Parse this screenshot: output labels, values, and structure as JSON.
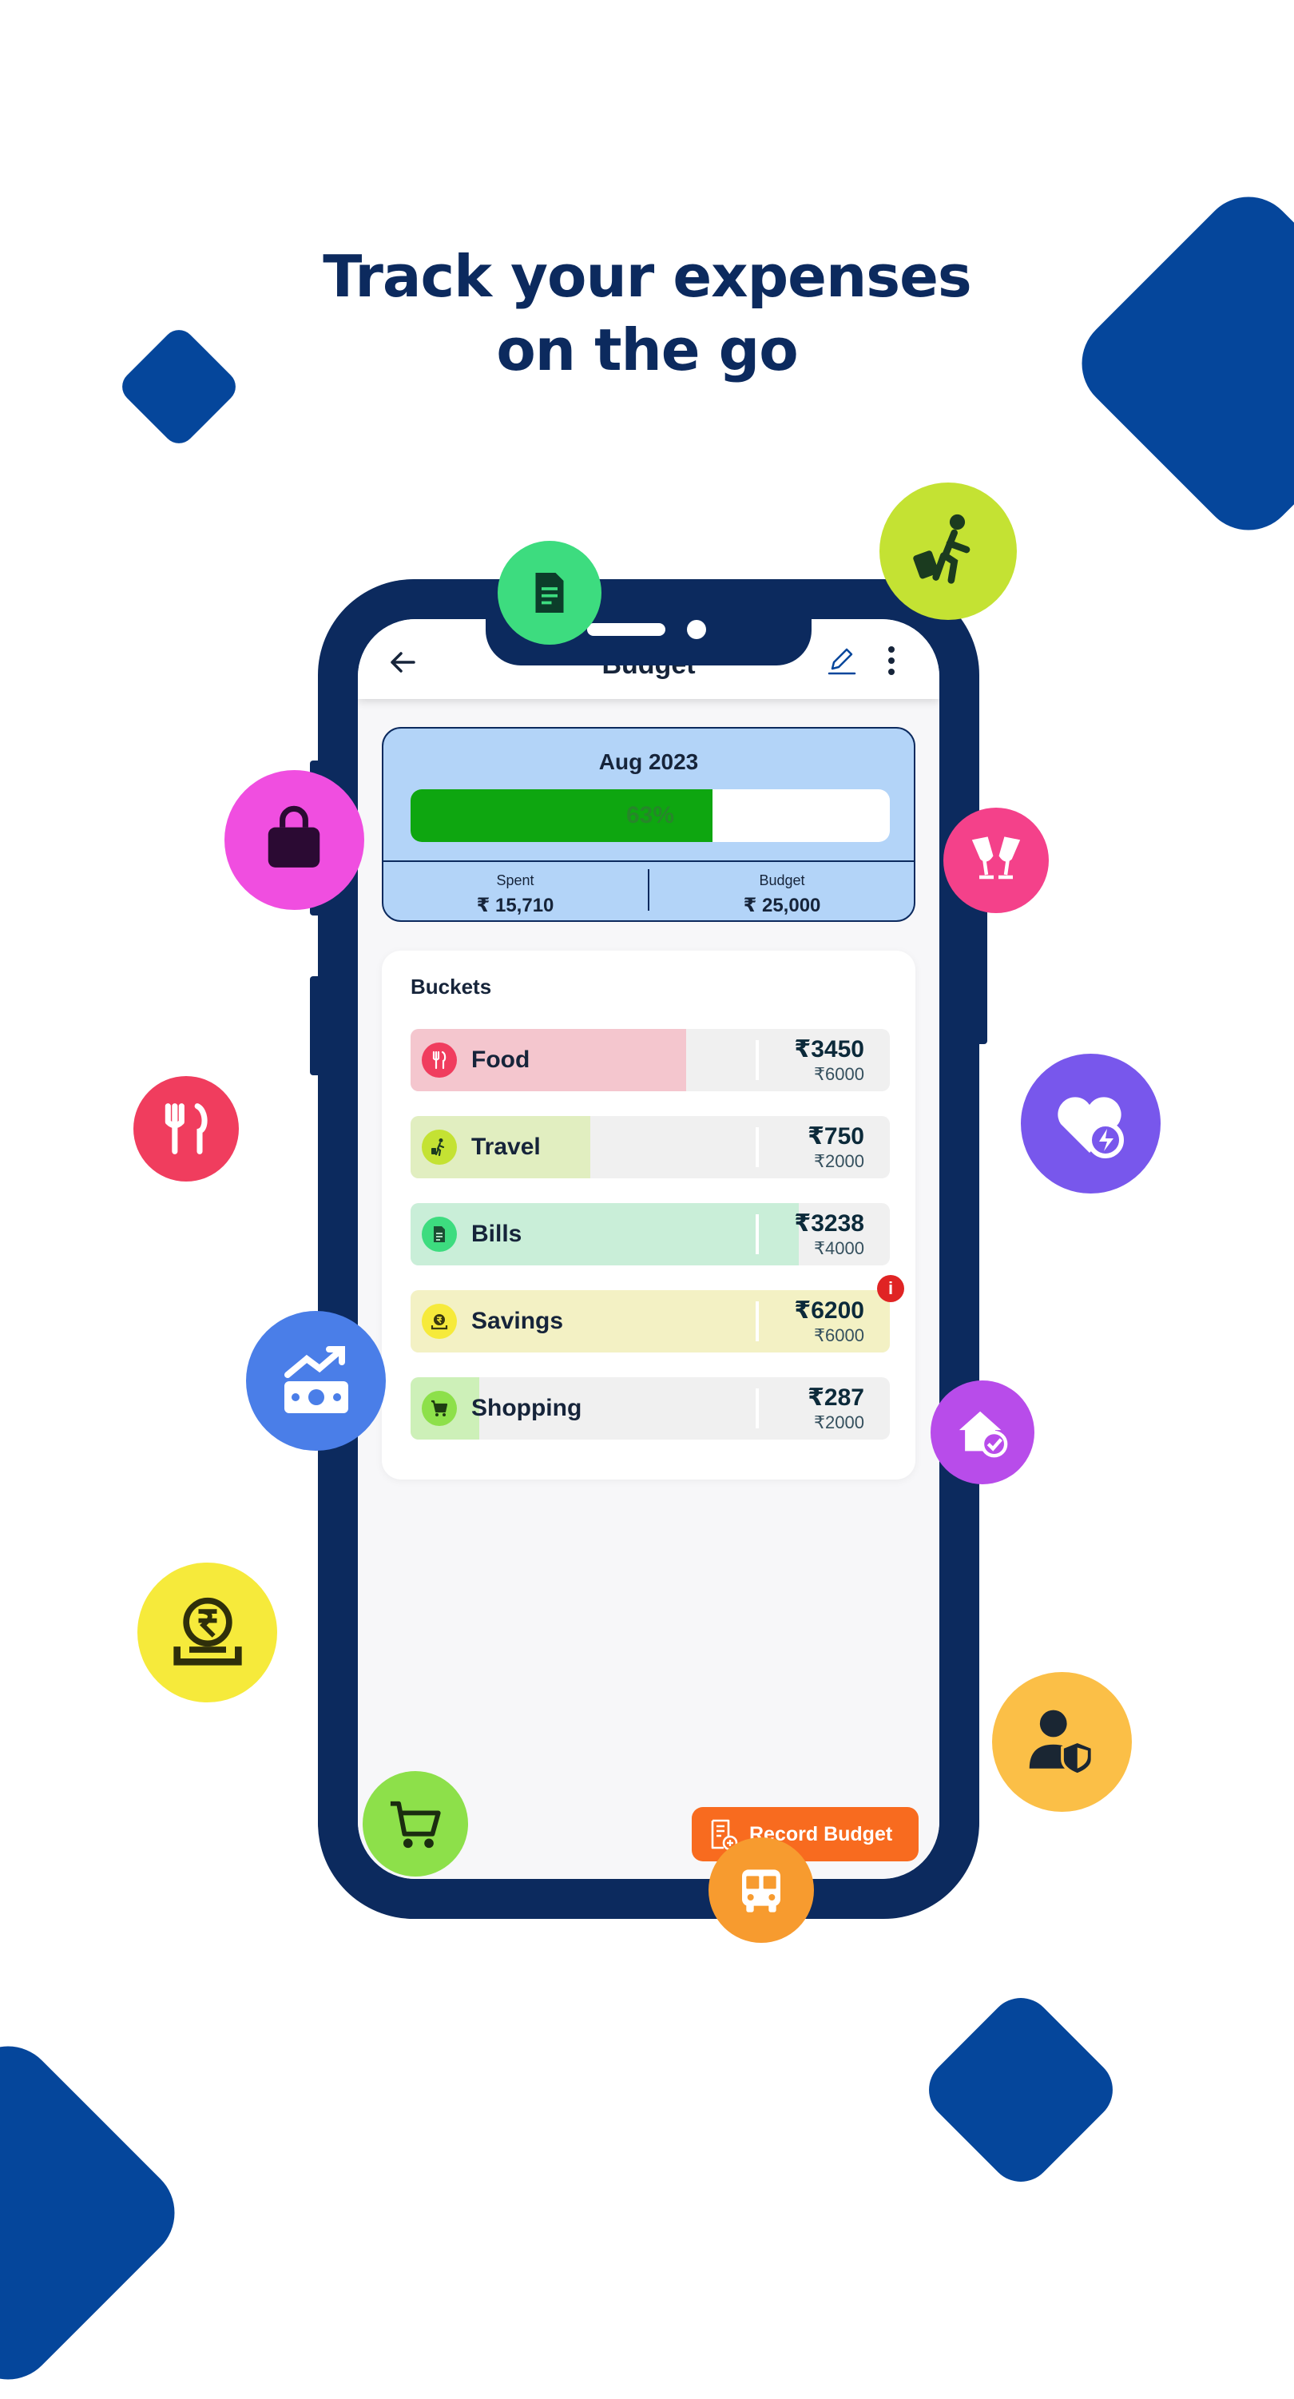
{
  "headline": {
    "line1": "Track your expenses",
    "line2": "on the go"
  },
  "colors": {
    "brand_navy": "#0c2a5e",
    "brand_blue": "#05469b",
    "progress_green": "#0ea610",
    "summary_bg": "#b3d4f8",
    "record_button": "#f86b1f",
    "alert_red": "#e02424"
  },
  "appbar": {
    "title": "Budget",
    "back_icon": "arrow-left-icon",
    "edit_icon": "pencil-icon",
    "more_icon": "more-vertical-icon"
  },
  "summary": {
    "month": "Aug 2023",
    "progress_percent": 63,
    "progress_text": "63%",
    "spent_label": "Spent",
    "spent_value": "₹ 15,710",
    "budget_label": "Budget",
    "budget_value": "₹ 25,000"
  },
  "buckets": {
    "title": "Buckets",
    "items": [
      {
        "name": "Food",
        "spent": "₹3450",
        "limit": "₹6000",
        "fill_fraction": 0.575,
        "fill_color": "#f4c6ce",
        "icon_color": "#f03d5e",
        "icon": "fork-knife-icon"
      },
      {
        "name": "Travel",
        "spent": "₹750",
        "limit": "₹2000",
        "fill_fraction": 0.375,
        "fill_color": "#e1eec0",
        "icon_color": "#c4e233",
        "icon": "walking-luggage-icon"
      },
      {
        "name": "Bills",
        "spent": "₹3238",
        "limit": "₹4000",
        "fill_fraction": 0.81,
        "fill_color": "#c9eed8",
        "icon_color": "#3ddc7f",
        "icon": "document-icon"
      },
      {
        "name": "Savings",
        "spent": "₹6200",
        "limit": "₹6000",
        "fill_fraction": 1.0,
        "fill_color": "#f3f1c4",
        "icon_color": "#f6ea3b",
        "icon": "rupee-coin-icon",
        "alert": "i"
      },
      {
        "name": "Shopping",
        "spent": "₹287",
        "limit": "₹2000",
        "fill_fraction": 0.1435,
        "fill_color": "#cdf0b8",
        "icon_color": "#8de04a",
        "icon": "cart-icon"
      }
    ]
  },
  "record_button": {
    "label": "Record Budget",
    "icon": "receipt-add-icon"
  },
  "floating_icons": [
    {
      "name": "document-icon",
      "color": "#3ddc7f"
    },
    {
      "name": "walking-luggage-icon",
      "color": "#c4e233"
    },
    {
      "name": "shopping-bag-icon",
      "color": "#f04ee0"
    },
    {
      "name": "cheers-glasses-icon",
      "color": "#f4418a"
    },
    {
      "name": "fork-knife-icon",
      "color": "#f03d5e"
    },
    {
      "name": "heart-lightning-icon",
      "color": "#7857ec"
    },
    {
      "name": "money-growth-icon",
      "color": "#4a7ee8"
    },
    {
      "name": "home-check-icon",
      "color": "#b84cea"
    },
    {
      "name": "rupee-coin-icon",
      "color": "#f6ea3b"
    },
    {
      "name": "user-shield-icon",
      "color": "#fbbf47"
    },
    {
      "name": "cart-icon",
      "color": "#8de04a"
    },
    {
      "name": "bus-icon",
      "color": "#f79b2f"
    }
  ]
}
